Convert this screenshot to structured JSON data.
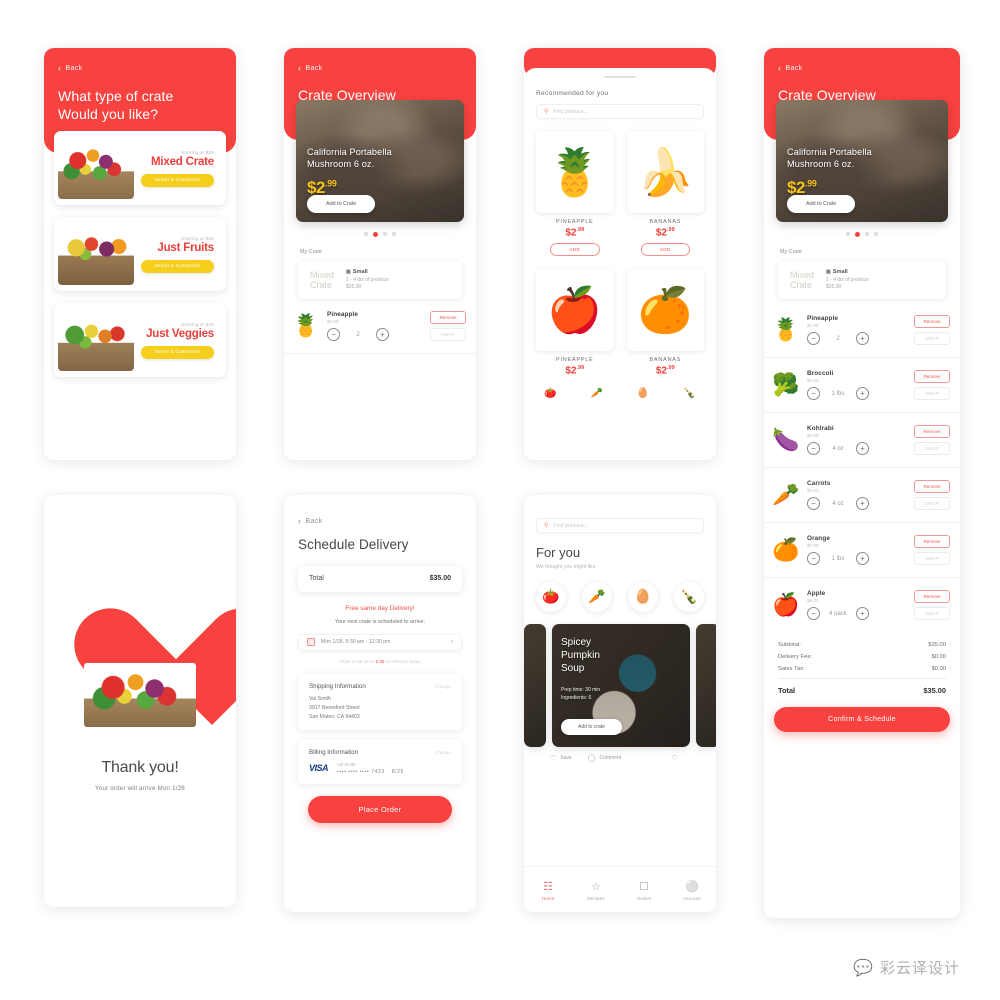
{
  "screen1": {
    "back_label": "Back",
    "title_line1": "What type of crate",
    "title_line2": "Would you like?",
    "crates": [
      {
        "starting": "Starting at $35",
        "name": "Mixed Crate",
        "button": "Select & Customize"
      },
      {
        "starting": "Starting at $35",
        "name": "Just Fruits",
        "button": "Select & Customize"
      },
      {
        "starting": "Starting at $35",
        "name": "Just Veggies",
        "button": "Select & Customize"
      }
    ]
  },
  "screen2": {
    "back_label": "Back",
    "title": "Crate Overview",
    "hero": {
      "title_line1": "California Portabella",
      "title_line2": "Mushroom 6 oz.",
      "price_main": "$2",
      "price_cents": ".99",
      "button": "Add to Crate"
    },
    "dots_active_index": 1,
    "dots_count": 4,
    "my_crate_label": "My Crate",
    "summary": {
      "crate_line1": "Mixed",
      "crate_line2": "Crate",
      "size": "Small",
      "desc": "2 - 4 lbs of produce",
      "price": "$35.00"
    },
    "item": {
      "name": "Pineapple",
      "price": "$4.99",
      "qty": "2",
      "remove": "Remove",
      "swap": "SWAP"
    }
  },
  "screen3": {
    "recommended_title": "Recommended for you",
    "search_placeholder": "Find produce...",
    "products": [
      {
        "name": "PINEAPPLE",
        "price_main": "$2",
        "price_cents": ".99",
        "button": "ADD",
        "icon": "pineapple"
      },
      {
        "name": "BANANAS",
        "price_main": "$2",
        "price_cents": ".99",
        "button": "ADD",
        "icon": "banana"
      },
      {
        "name": "PINEAPPLE",
        "price_main": "$2",
        "price_cents": ".99",
        "button": "",
        "icon": "apple"
      },
      {
        "name": "BANANAS",
        "price_main": "$2",
        "price_cents": ".99",
        "button": "",
        "icon": "orange"
      }
    ],
    "categories": [
      "tomato-icon",
      "carrot-icon",
      "egg-icon",
      "bottle-icon"
    ]
  },
  "screen4": {
    "back_label": "Back",
    "title": "Crate Overview",
    "hero": {
      "title_line1": "California Portabella",
      "title_line2": "Mushroom 6 oz.",
      "price_main": "$2",
      "price_cents": ".99",
      "button": "Add to Crate"
    },
    "my_crate_label": "My Crate",
    "summary": {
      "crate_line1": "Mixed",
      "crate_line2": "Crate",
      "size": "Small",
      "desc": "2 - 4 lbs of produce",
      "price": "$35.00"
    },
    "items": [
      {
        "name": "Pineapple",
        "price": "$4.99",
        "qty": "2",
        "remove": "Remove",
        "swap": "SWAP",
        "icon": "pineapple"
      },
      {
        "name": "Broccoli",
        "price": "$4.50",
        "qty": "1 lbs",
        "remove": "Remove",
        "swap": "SWAP",
        "icon": "broccoli"
      },
      {
        "name": "Kohlrabi",
        "price": "$6.99",
        "qty": "4 oz",
        "remove": "Remove",
        "swap": "SWAP",
        "icon": "kohlrabi"
      },
      {
        "name": "Carrots",
        "price": "$5.00",
        "qty": "4 oz",
        "remove": "Remove",
        "swap": "SWAP",
        "icon": "carrot"
      },
      {
        "name": "Orange",
        "price": "$7.99",
        "qty": "1 lbs",
        "remove": "Remove",
        "swap": "SWAP",
        "icon": "orange"
      },
      {
        "name": "Apple",
        "price": "$6.00",
        "qty": "4 pack",
        "remove": "Remove",
        "swap": "SWAP",
        "icon": "apple"
      }
    ],
    "totals": [
      {
        "label": "Subtotal:",
        "value": "$35.00"
      },
      {
        "label": "Delivery Fee:",
        "value": "$0.00"
      },
      {
        "label": "Sales Tax:",
        "value": "$0.00"
      }
    ],
    "grand_label": "Total",
    "grand_value": "$35.00",
    "confirm_button": "Confirm & Schedule"
  },
  "screen5": {
    "title": "Thank you!",
    "subtitle": "Your order will arrive  Mon 1/28"
  },
  "screen6": {
    "back_label": "Back",
    "title": "Schedule Delivery",
    "total_label": "Total",
    "total_value": "$35.00",
    "free_delivery": "Free same day Delivery!",
    "schedule_note": "Your next crate is scheduled to arrive:",
    "date_value": "Mon 1/28, 9:30 am - 12:30 pm",
    "order_in_prefix": "Order in 45:38 or ",
    "order_in_highlight": "1:30",
    "order_in_suffix": " for delivery today",
    "shipping": {
      "title": "Shipping Information",
      "change": "Change",
      "name": "Val Smith",
      "street": "3917 Beresford Street",
      "city": "San Mateo, CA 94403"
    },
    "billing": {
      "title": "Billing Information",
      "change": "Change",
      "brand": "VISA",
      "name": "Val Smith",
      "number": "•••• •••• •••• 7423",
      "expiry": "8/25"
    },
    "place_order": "Place Order"
  },
  "screen7": {
    "search_placeholder": "Find produce...",
    "title": "For you",
    "subtitle": "We thought you might like",
    "chips": [
      "tomato-icon",
      "carrot-icon",
      "egg-icon",
      "bottle-icon"
    ],
    "recipe": {
      "title_line1": "Spicey",
      "title_line2": "Pumpkin",
      "title_line3": "Soup",
      "prep": "Prep time: 30 min",
      "ingredients": "Ingredients: 6",
      "button": "Add to crate"
    },
    "reactions": {
      "save": "Save",
      "comment": "Comment"
    },
    "nav": [
      {
        "label": "Home",
        "icon": "grid-icon"
      },
      {
        "label": "Recipes",
        "icon": "bowl-icon"
      },
      {
        "label": "Orders",
        "icon": "box-icon"
      },
      {
        "label": "Account",
        "icon": "person-icon"
      }
    ]
  },
  "watermark": {
    "text": "彩云译设计",
    "icon": "wechat-icon"
  },
  "colors": {
    "brand_red": "#f8423f",
    "accent_yellow": "#f5cf1c",
    "price_yellow": "#f5c518"
  }
}
